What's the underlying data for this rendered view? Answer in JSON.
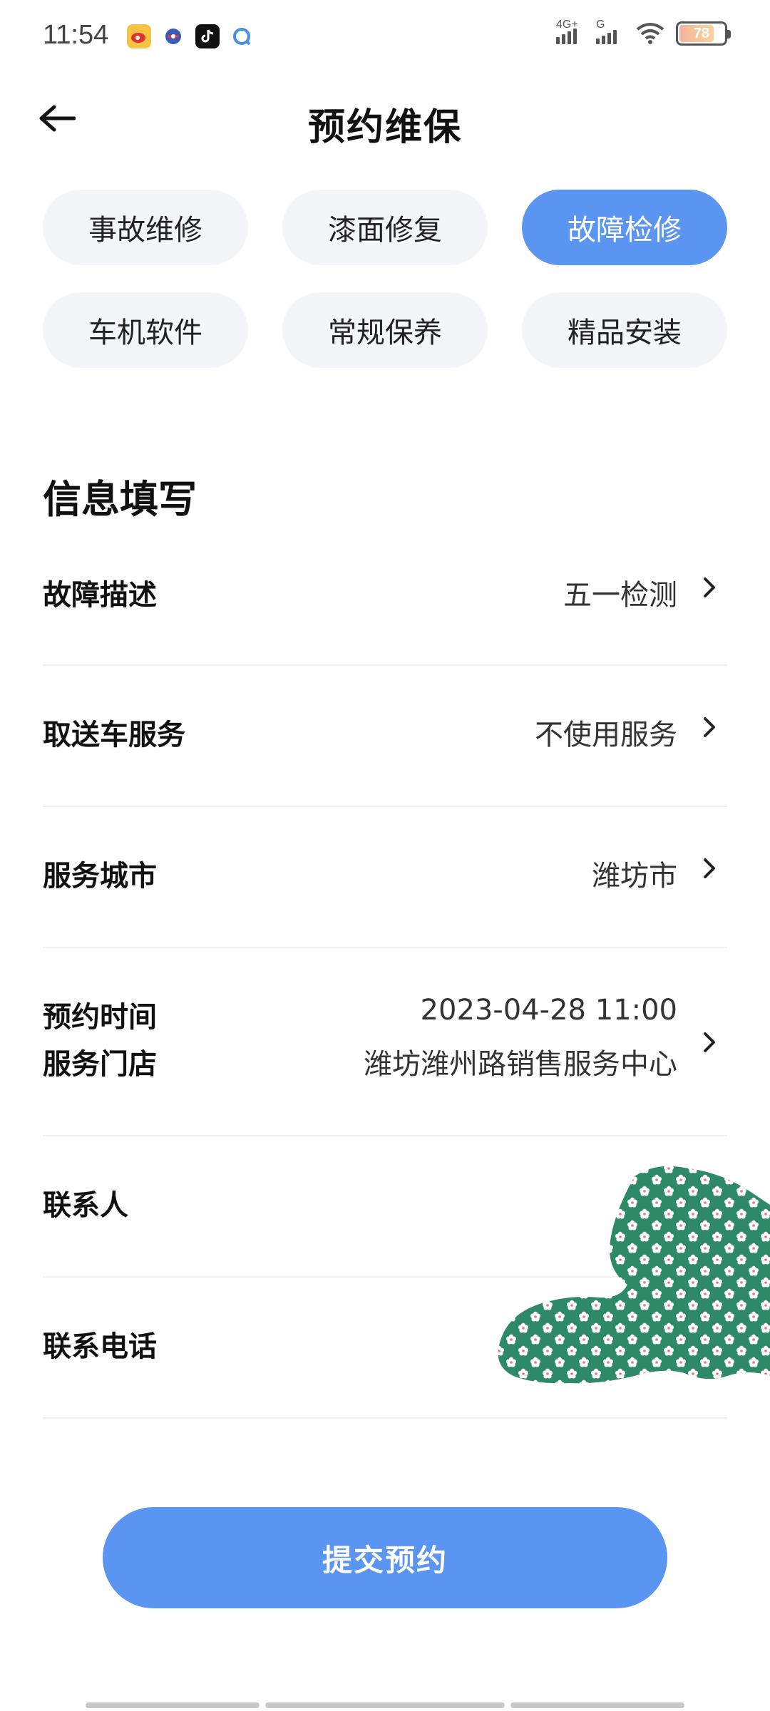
{
  "status_bar": {
    "time": "11:54",
    "notification_icons": [
      "weibo-icon",
      "app-icon",
      "tiktok-icon",
      "browser-icon"
    ],
    "network_primary": "4G+",
    "network_secondary": "G",
    "battery_level": "78"
  },
  "header": {
    "title": "预约维保"
  },
  "categories": {
    "items": [
      {
        "label": "事故维修",
        "active": false
      },
      {
        "label": "漆面修复",
        "active": false
      },
      {
        "label": "故障检修",
        "active": true
      },
      {
        "label": "车机软件",
        "active": false
      },
      {
        "label": "常规保养",
        "active": false
      },
      {
        "label": "精品安装",
        "active": false
      }
    ]
  },
  "section": {
    "title": "信息填写"
  },
  "form": {
    "fault": {
      "label": "故障描述",
      "value": "五一检测"
    },
    "pickup": {
      "label": "取送车服务",
      "value": "不使用服务"
    },
    "city": {
      "label": "服务城市",
      "value": "潍坊市"
    },
    "time": {
      "label": "预约时间",
      "value": "2023-04-28 11:00"
    },
    "store": {
      "label": "服务门店",
      "value": "潍坊潍州路销售服务中心"
    },
    "contact": {
      "label": "联系人",
      "value": ""
    },
    "phone": {
      "label": "联系电话",
      "value": ""
    }
  },
  "submit": {
    "label": "提交预约"
  },
  "colors": {
    "accent": "#5b95f2",
    "chip_bg": "#f3f5f8",
    "decor_green": "#2e8a66"
  }
}
